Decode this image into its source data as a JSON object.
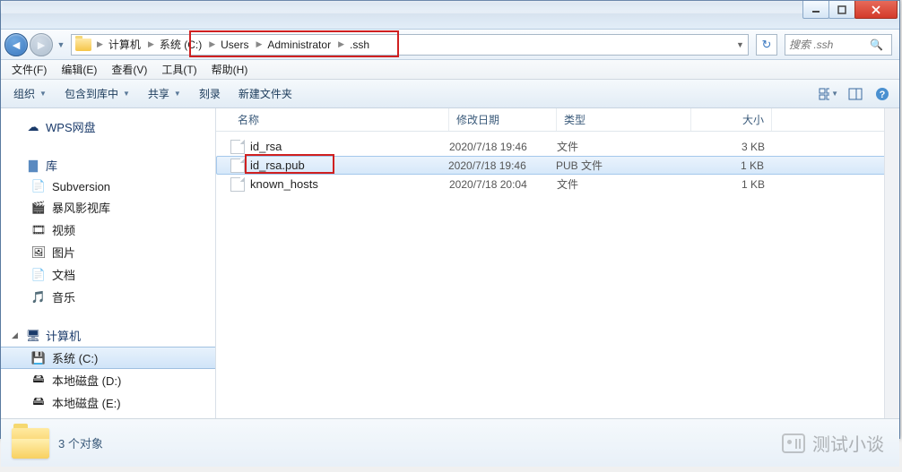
{
  "breadcrumbs": [
    "计算机",
    "系统 (C:)",
    "Users",
    "Administrator",
    ".ssh"
  ],
  "search_placeholder": "搜索 .ssh",
  "menus": {
    "file": "文件(F)",
    "edit": "编辑(E)",
    "view": "查看(V)",
    "tools": "工具(T)",
    "help": "帮助(H)"
  },
  "toolbar": {
    "organize": "组织",
    "include": "包含到库中",
    "share": "共享",
    "burn": "刻录",
    "newfolder": "新建文件夹"
  },
  "sidebar": {
    "wps": "WPS网盘",
    "library": "库",
    "lib_items": [
      {
        "label": "Subversion",
        "icon": "subversion"
      },
      {
        "label": "暴风影视库",
        "icon": "video-lib"
      },
      {
        "label": "视频",
        "icon": "video"
      },
      {
        "label": "图片",
        "icon": "picture"
      },
      {
        "label": "文档",
        "icon": "document"
      },
      {
        "label": "音乐",
        "icon": "music"
      }
    ],
    "computer": "计算机",
    "drives": [
      {
        "label": "系统 (C:)",
        "selected": true
      },
      {
        "label": "本地磁盘 (D:)",
        "selected": false
      },
      {
        "label": "本地磁盘 (E:)",
        "selected": false
      }
    ]
  },
  "columns": {
    "name": "名称",
    "date": "修改日期",
    "type": "类型",
    "size": "大小"
  },
  "files": [
    {
      "name": "id_rsa",
      "date": "2020/7/18 19:46",
      "type": "文件",
      "size": "3 KB",
      "selected": false
    },
    {
      "name": "id_rsa.pub",
      "date": "2020/7/18 19:46",
      "type": "PUB 文件",
      "size": "1 KB",
      "selected": true
    },
    {
      "name": "known_hosts",
      "date": "2020/7/18 20:04",
      "type": "文件",
      "size": "1 KB",
      "selected": false
    }
  ],
  "status": "3 个对象",
  "watermark": "测试小谈"
}
